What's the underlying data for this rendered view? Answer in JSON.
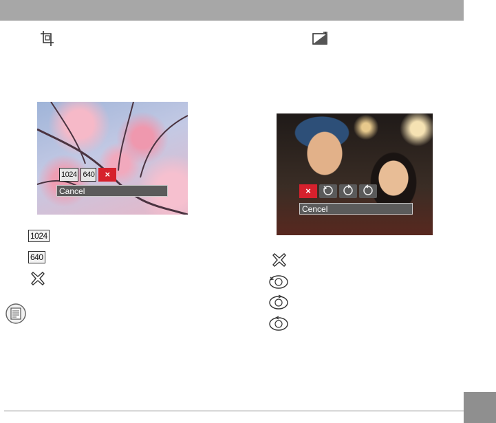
{
  "page": {
    "left_heading_icon": "crop-icon",
    "right_heading_icon": "exposure-correction-icon",
    "memo_icon": "memo-note-icon"
  },
  "left_screen": {
    "photo": "cherry-blossom-photo",
    "buttons": [
      "1024",
      "640"
    ],
    "cancel_glyph": "×",
    "status_text": "Cancel"
  },
  "left_legend": {
    "items": [
      {
        "badge": "1024",
        "icon": "size-1024-icon"
      },
      {
        "badge": "640",
        "icon": "size-640-icon"
      },
      {
        "icon": "cancel-x-icon"
      }
    ]
  },
  "right_screen": {
    "photo": "two-people-photo",
    "cancel_glyph": "×",
    "rotation_icons": [
      "rotate-icon",
      "rotate-icon",
      "rotate-icon"
    ],
    "status_text": "Cencel"
  },
  "right_legend": {
    "items": [
      {
        "icon": "cancel-x-icon"
      },
      {
        "icon": "rotate-icon"
      },
      {
        "icon": "rotate-icon"
      },
      {
        "icon": "rotate-icon"
      }
    ]
  },
  "colors": {
    "header": "#a7a7a7",
    "accent_red": "#d6212d",
    "page_tab": "#8f8f8f"
  }
}
